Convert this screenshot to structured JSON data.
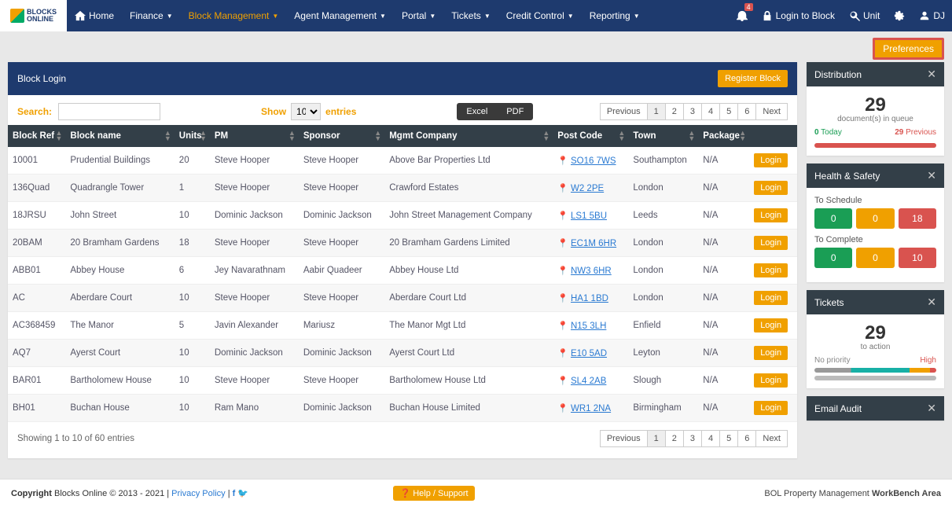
{
  "logo": {
    "top": "BLOCKS",
    "bottom": "ONLINE"
  },
  "nav": [
    {
      "label": "Home",
      "icon": "home"
    },
    {
      "label": "Finance",
      "dd": true
    },
    {
      "label": "Block Management",
      "dd": true,
      "active": true
    },
    {
      "label": "Agent Management",
      "dd": true
    },
    {
      "label": "Portal",
      "dd": true
    },
    {
      "label": "Tickets",
      "dd": true
    },
    {
      "label": "Credit Control",
      "dd": true
    },
    {
      "label": "Reporting",
      "dd": true
    }
  ],
  "nav_right": {
    "badge": "4",
    "login_block": "Login to Block",
    "unit": "Unit",
    "user": "DJ"
  },
  "preferences_btn": "Preferences",
  "block_login": {
    "title": "Block Login",
    "register": "Register Block",
    "search_label": "Search:",
    "show": "Show",
    "entries": "entries",
    "length": "10",
    "export": {
      "excel": "Excel",
      "pdf": "PDF"
    },
    "pager": {
      "prev": "Previous",
      "next": "Next",
      "pages": [
        "1",
        "2",
        "3",
        "4",
        "5",
        "6"
      ],
      "active": "1"
    },
    "cols": [
      "Block Ref",
      "Block name",
      "Units",
      "PM",
      "Sponsor",
      "Mgmt Company",
      "Post Code",
      "Town",
      "Package",
      ""
    ],
    "rows": [
      {
        "ref": "10001",
        "name": "Prudential Buildings",
        "units": "20",
        "pm": "Steve Hooper",
        "sponsor": "Steve Hooper",
        "mgmt": "Above Bar Properties Ltd",
        "pc": "SO16 7WS",
        "town": "Southampton",
        "pkg": "N/A"
      },
      {
        "ref": "136Quad",
        "name": "Quadrangle Tower",
        "units": "1",
        "pm": "Steve Hooper",
        "sponsor": "Steve Hooper",
        "mgmt": "Crawford Estates",
        "pc": "W2 2PE",
        "town": "London",
        "pkg": "N/A"
      },
      {
        "ref": "18JRSU",
        "name": "John Street",
        "units": "10",
        "pm": "Dominic Jackson",
        "sponsor": "Dominic Jackson",
        "mgmt": "John Street Management Company",
        "pc": "LS1 5BU",
        "town": "Leeds",
        "pkg": "N/A"
      },
      {
        "ref": "20BAM",
        "name": "20 Bramham Gardens",
        "units": "18",
        "pm": "Steve Hooper",
        "sponsor": "Steve Hooper",
        "mgmt": "20 Bramham Gardens Limited",
        "pc": "EC1M 6HR",
        "town": "London",
        "pkg": "N/A"
      },
      {
        "ref": "ABB01",
        "name": "Abbey House",
        "units": "6",
        "pm": "Jey Navarathnam",
        "sponsor": "Aabir Quadeer",
        "mgmt": "Abbey House Ltd",
        "pc": "NW3 6HR",
        "town": "London",
        "pkg": "N/A"
      },
      {
        "ref": "AC",
        "name": "Aberdare Court",
        "units": "10",
        "pm": "Steve Hooper",
        "sponsor": "Steve Hooper",
        "mgmt": "Aberdare Court Ltd",
        "pc": "HA1 1BD",
        "town": "London",
        "pkg": "N/A"
      },
      {
        "ref": "AC368459",
        "name": "The Manor",
        "units": "5",
        "pm": "Javin Alexander",
        "sponsor": "Mariusz",
        "mgmt": "The Manor Mgt Ltd",
        "pc": "N15 3LH",
        "town": "Enfield",
        "pkg": "N/A"
      },
      {
        "ref": "AQ7",
        "name": "Ayerst Court",
        "units": "10",
        "pm": "Dominic Jackson",
        "sponsor": "Dominic Jackson",
        "mgmt": "Ayerst Court Ltd",
        "pc": "E10 5AD",
        "town": "Leyton",
        "pkg": "N/A"
      },
      {
        "ref": "BAR01",
        "name": "Bartholomew House",
        "units": "10",
        "pm": "Steve Hooper",
        "sponsor": "Steve Hooper",
        "mgmt": "Bartholomew House Ltd",
        "pc": "SL4 2AB",
        "town": "Slough",
        "pkg": "N/A"
      },
      {
        "ref": "BH01",
        "name": "Buchan House",
        "units": "10",
        "pm": "Ram Mano",
        "sponsor": "Dominic Jackson",
        "mgmt": "Buchan House Limited",
        "pc": "WR1 2NA",
        "town": "Birmingham",
        "pkg": "N/A"
      }
    ],
    "login_label": "Login",
    "info": "Showing 1 to 10 of 60 entries"
  },
  "distribution": {
    "title": "Distribution",
    "count": "29",
    "sub": "document(s) in queue",
    "today_n": "0",
    "today_l": "Today",
    "prev_n": "29",
    "prev_l": "Previous"
  },
  "hs": {
    "title": "Health & Safety",
    "schedule": "To Schedule",
    "s": [
      "0",
      "0",
      "18"
    ],
    "complete": "To Complete",
    "c": [
      "0",
      "0",
      "10"
    ]
  },
  "tickets": {
    "title": "Tickets",
    "count": "29",
    "sub": "to action",
    "left": "No priority",
    "right": "High"
  },
  "email_audit": {
    "title": "Email Audit"
  },
  "footer": {
    "copyright_bold": "Copyright",
    "copyright_rest": " Blocks Online © 2013 - 2021 | ",
    "privacy": "Privacy Policy",
    "help": "Help / Support",
    "workbench_pre": "BOL Property Management ",
    "workbench_bold": "WorkBench Area"
  }
}
